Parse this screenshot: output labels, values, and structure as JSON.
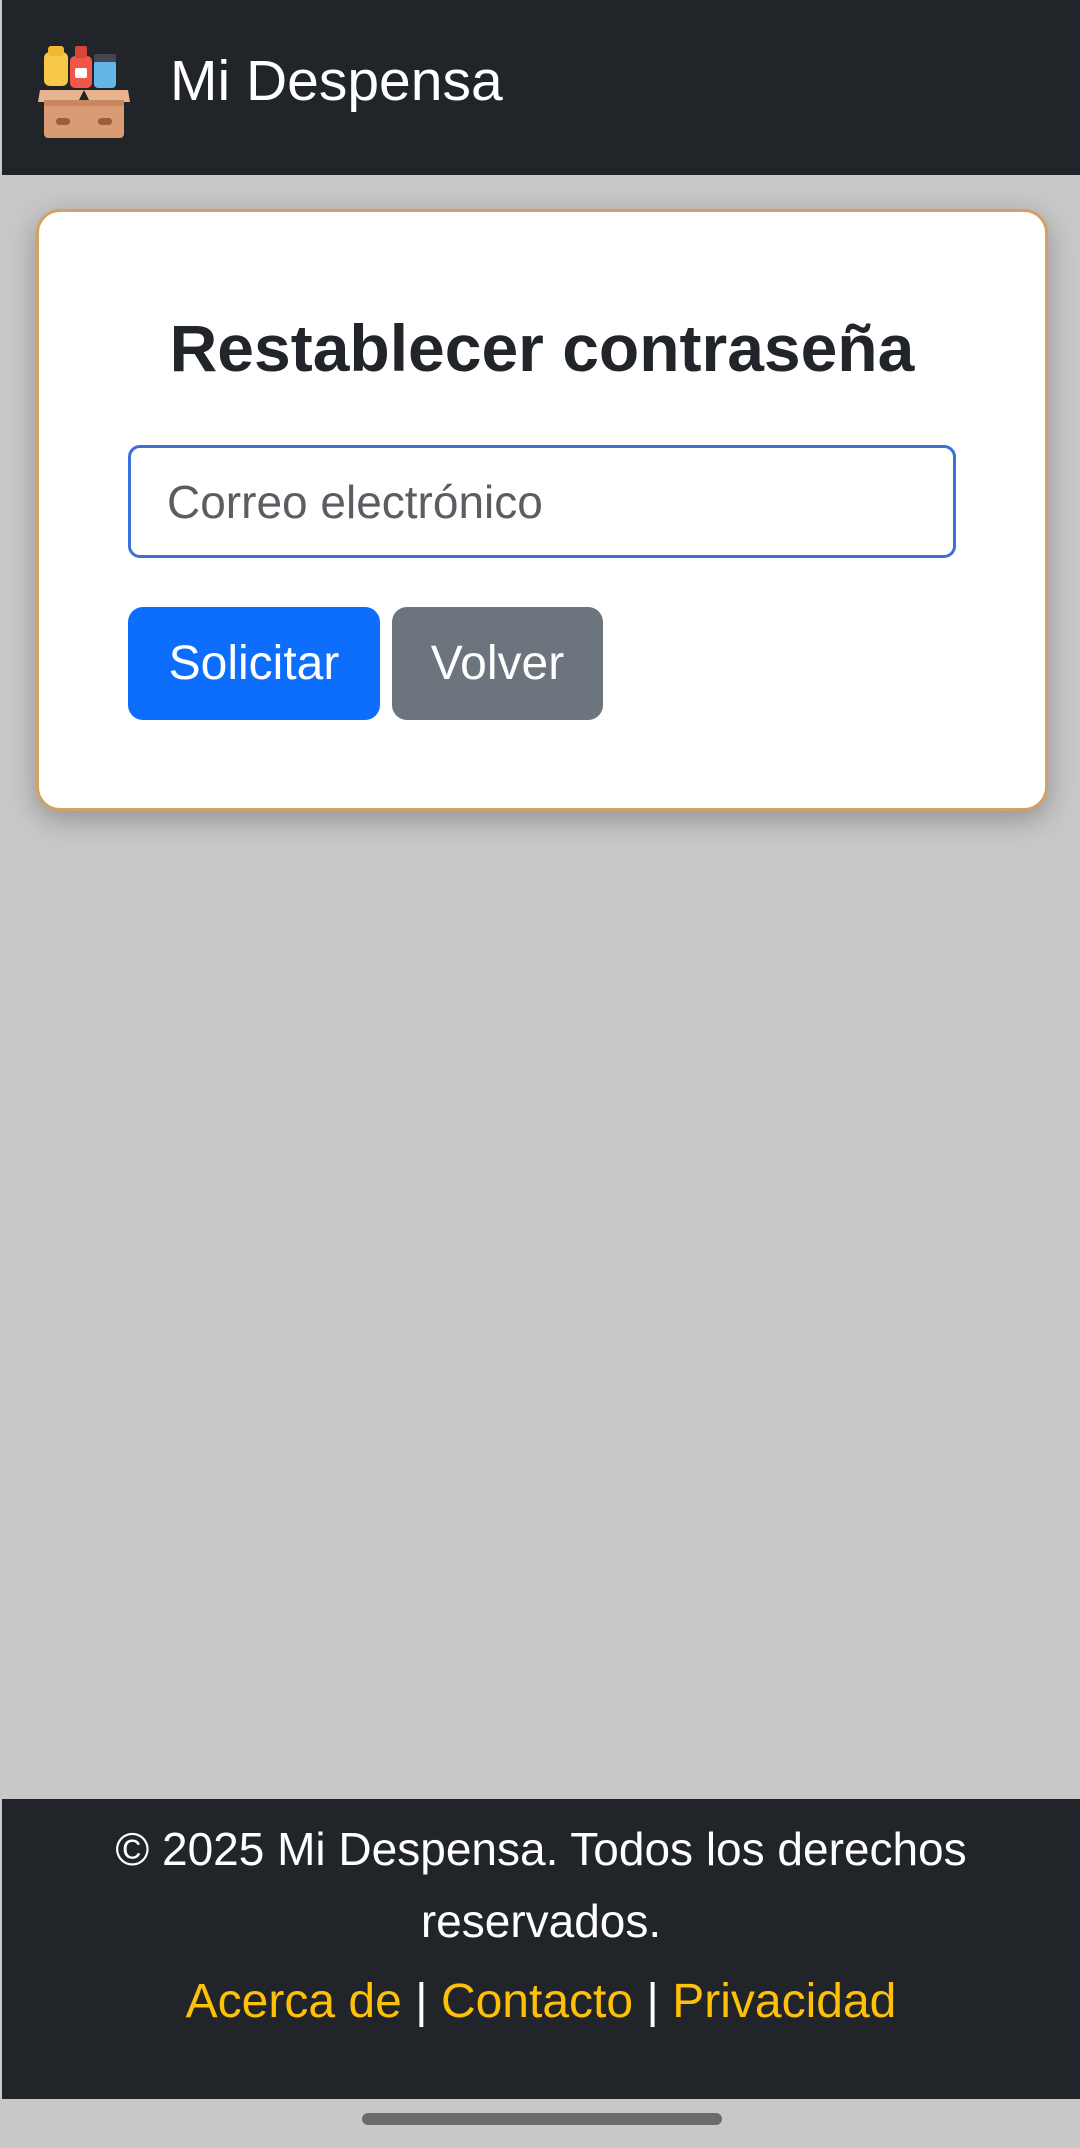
{
  "app": {
    "title": "Mi Despensa",
    "logo_icon": "pantry-box-icon"
  },
  "reset_form": {
    "title": "Restablecer contraseña",
    "email_placeholder": "Correo electrónico",
    "email_value": "",
    "submit_label": "Solicitar",
    "back_label": "Volver"
  },
  "footer": {
    "copyright": "© 2025 Mi Despensa. Todos los derechos reservados.",
    "links": [
      "Acerca de",
      "Contacto",
      "Privacidad"
    ],
    "separator": "|"
  },
  "colors": {
    "navbar": "#212529",
    "background": "#c8c8c8",
    "primary": "#0d6efd",
    "secondary": "#6c757d",
    "link": "#ffc107",
    "card_border": "#d4a06a"
  }
}
